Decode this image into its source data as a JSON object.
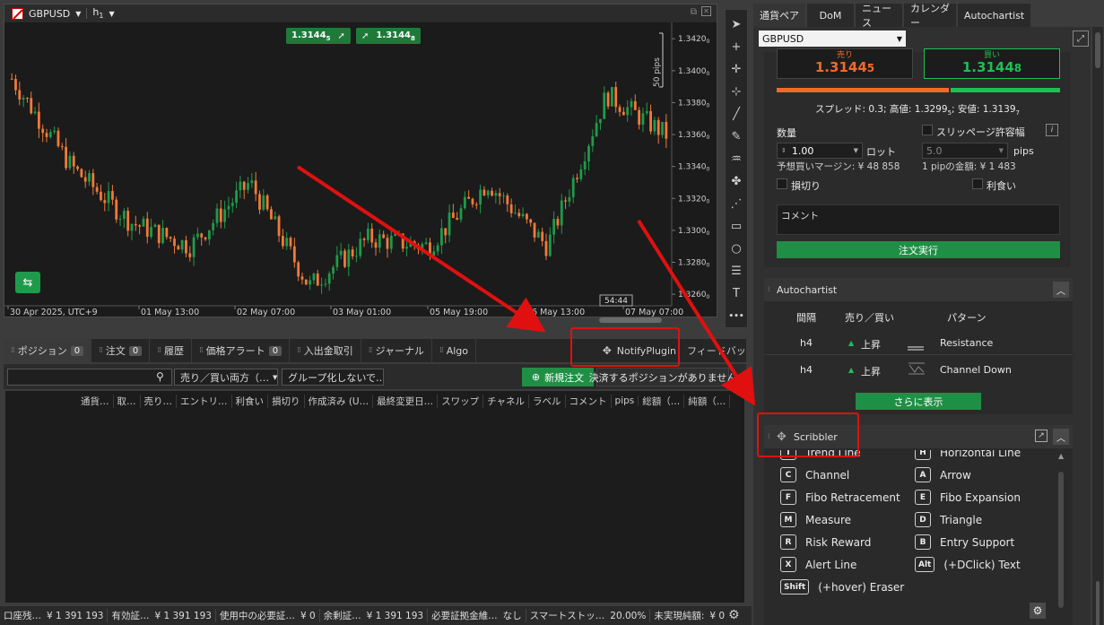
{
  "chart": {
    "symbol": "GBPUSD",
    "timeframe": "h",
    "timeframe_sub": "1",
    "sell_price_main": "1.3144",
    "sell_price_pip": "5",
    "buy_price_main": "1.3144",
    "buy_price_pip": "8",
    "pips_label": "50 pips",
    "countdown": "54:44",
    "y_ticks": [
      {
        "main": "1.3420",
        "sub": "0",
        "v": 1.342
      },
      {
        "main": "1.3400",
        "sub": "0",
        "v": 1.34
      },
      {
        "main": "1.3380",
        "sub": "0",
        "v": 1.338
      },
      {
        "main": "1.3360",
        "sub": "0",
        "v": 1.336
      },
      {
        "main": "1.3340",
        "sub": "0",
        "v": 1.334
      },
      {
        "main": "1.3320",
        "sub": "0",
        "v": 1.332
      },
      {
        "main": "1.3300",
        "sub": "0",
        "v": 1.33
      },
      {
        "main": "1.3280",
        "sub": "0",
        "v": 1.328
      },
      {
        "main": "1.3260",
        "sub": "0",
        "v": 1.326
      }
    ],
    "x_ticks": [
      "30 Apr 2025, UTC+9",
      "01 May 13:00",
      "02 May 07:00",
      "03 May 01:00",
      "05 May 19:00",
      "06 May 13:00",
      "07 May 07:00"
    ],
    "up_color": "#1f9a4a",
    "down_color": "#f07a3a"
  },
  "chart_data": {
    "type": "line",
    "ylim": [
      1.3255,
      1.3428
    ],
    "x": [
      "30 Apr 2025, UTC+9",
      "01 May 13:00",
      "02 May 07:00",
      "03 May 01:00",
      "05 May 19:00",
      "06 May 13:00",
      "07 May 07:00"
    ],
    "series": [
      {
        "values": [
          1.3395,
          1.334,
          1.3305,
          1.329,
          1.333,
          1.3265,
          1.3295,
          1.329,
          1.333,
          1.329,
          1.3385,
          1.336
        ]
      }
    ]
  },
  "tools": [
    "cursor-icon",
    "crosshair-icon",
    "crosshair2-icon",
    "crosshair3-icon",
    "line-icon",
    "pen-icon",
    "brush-icon",
    "pin-icon",
    "dots-line-icon",
    "rectangle-icon",
    "circle-icon",
    "fib-icon",
    "text-icon",
    "more-icon"
  ],
  "tool_glyphs": [
    "➤",
    "+",
    "✛",
    "⊹",
    "╱",
    "✎",
    "♒",
    "✤",
    "⋰",
    "▭",
    "○",
    "☰",
    "T",
    "•••"
  ],
  "bottom_tabs": [
    {
      "label": "ポジション",
      "count": "0"
    },
    {
      "label": "注文",
      "count": "0"
    },
    {
      "label": "履歴",
      "count": ""
    },
    {
      "label": "価格アラート",
      "count": "0"
    },
    {
      "label": "入出金取引",
      "count": ""
    },
    {
      "label": "ジャーナル",
      "count": ""
    },
    {
      "label": "Algo",
      "count": ""
    }
  ],
  "notify_plugin": "NotifyPlugin",
  "feedback": "フィードバック",
  "positions": {
    "search_placeholder": "",
    "side_select": "売り／買い両方（…",
    "group_select": "グループ化しないで…",
    "new_order": "新規注文",
    "close_positions": "決済するポジションがありません",
    "columns": [
      "通貨…",
      "取…",
      "売り…",
      "エントリ…",
      "利食い",
      "損切り",
      "作成済み (U…",
      "最終変更日…",
      "スワップ",
      "チャネル",
      "ラベル",
      "コメント",
      "pips",
      "総額（…",
      "純額（…"
    ]
  },
  "status": [
    {
      "label": "口座残…",
      "value": "¥ 1 391 193"
    },
    {
      "label": "有効証…",
      "value": "¥ 1 391 193"
    },
    {
      "label": "使用中の必要証…",
      "value": "¥ 0"
    },
    {
      "label": "余剰証…",
      "value": "¥ 1 391 193"
    },
    {
      "label": "必要証拠金維…",
      "value": "なし"
    },
    {
      "label": "スマートストッ…",
      "value": "20.00%"
    },
    {
      "label": "未実現純額:",
      "value": "¥ 0"
    }
  ],
  "right_tabs": [
    "通貨ペア",
    "DoM",
    "ニュース",
    "カレンダー",
    "Autochartist"
  ],
  "trade": {
    "symbol": "GBPUSD",
    "sell_label": "売り",
    "buy_label": "買い",
    "sell_main": "1.3144",
    "sell_pip": "5",
    "buy_main": "1.3144",
    "buy_pip": "8",
    "spread_info": "スプレッド: 0.3; 高値: 1.3299",
    "spread_sub": "5",
    "low_info": "; 安値: 1.3139",
    "low_sub": "7",
    "qty_label": "数量",
    "slippage_label": "スリッページ許容幅",
    "qty_value": "1.00",
    "lot_label": "ロット",
    "slip_value": "5.0",
    "pips_label": "pips",
    "margin_label": "予想買いマージン: ¥ 48 858",
    "pip_value_label": "1 pipの金額: ¥ 1 483",
    "stoploss_label": "損切り",
    "takeprofit_label": "利食い",
    "comment_placeholder": "コメント",
    "execute_label": "注文実行",
    "sell_color": "#f06a2a",
    "buy_color": "#1fbf55"
  },
  "autochartist": {
    "title": "Autochartist",
    "headers": [
      "間隔",
      "売り／買い",
      "パターン"
    ],
    "rows": [
      {
        "interval": "h4",
        "direction": "上昇",
        "pattern": "Resistance",
        "icon": "resistance-icon"
      },
      {
        "interval": "h4",
        "direction": "上昇",
        "pattern": "Channel Down",
        "icon": "channel-down-icon"
      }
    ],
    "more_label": "さらに表示"
  },
  "scribbler": {
    "title": "Scribbler",
    "left": [
      {
        "key": "T",
        "label": "Trend Line"
      },
      {
        "key": "C",
        "label": "Channel"
      },
      {
        "key": "F",
        "label": "Fibo Retracement"
      },
      {
        "key": "M",
        "label": "Measure"
      },
      {
        "key": "R",
        "label": "Risk Reward"
      },
      {
        "key": "X",
        "label": "Alert Line"
      },
      {
        "key": "Shift",
        "label": "(+hover) Eraser"
      }
    ],
    "right": [
      {
        "key": "H",
        "label": "Horizontal Line"
      },
      {
        "key": "A",
        "label": "Arrow"
      },
      {
        "key": "E",
        "label": "Fibo Expansion"
      },
      {
        "key": "D",
        "label": "Triangle"
      },
      {
        "key": "B",
        "label": "Entry Support"
      },
      {
        "key": "Alt",
        "label": "(+DClick) Text"
      }
    ]
  },
  "annotation_color": "#e01010"
}
